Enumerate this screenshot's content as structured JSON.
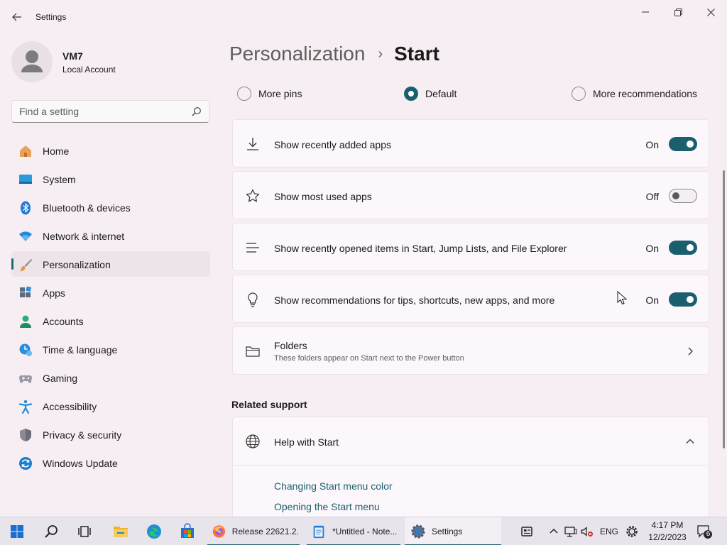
{
  "window": {
    "app_title": "Settings"
  },
  "profile": {
    "name": "VM7",
    "account_type": "Local Account"
  },
  "search": {
    "placeholder": "Find a setting",
    "value": ""
  },
  "sidebar": {
    "items": [
      {
        "label": "Home",
        "icon": "home-icon"
      },
      {
        "label": "System",
        "icon": "system-icon"
      },
      {
        "label": "Bluetooth & devices",
        "icon": "bluetooth-icon"
      },
      {
        "label": "Network & internet",
        "icon": "wifi-icon"
      },
      {
        "label": "Personalization",
        "icon": "brush-icon",
        "selected": true
      },
      {
        "label": "Apps",
        "icon": "apps-icon"
      },
      {
        "label": "Accounts",
        "icon": "accounts-icon"
      },
      {
        "label": "Time & language",
        "icon": "time-language-icon"
      },
      {
        "label": "Gaming",
        "icon": "gamepad-icon"
      },
      {
        "label": "Accessibility",
        "icon": "accessibility-icon"
      },
      {
        "label": "Privacy & security",
        "icon": "shield-icon"
      },
      {
        "label": "Windows Update",
        "icon": "update-icon"
      }
    ]
  },
  "breadcrumb": {
    "parent": "Personalization",
    "separator": "›",
    "current": "Start"
  },
  "layout_options": [
    {
      "label": "More pins",
      "selected": false
    },
    {
      "label": "Default",
      "selected": true
    },
    {
      "label": "More recommendations",
      "selected": false
    }
  ],
  "settings": [
    {
      "title": "Show recently added apps",
      "state": "On",
      "on": true,
      "icon": "download-icon"
    },
    {
      "title": "Show most used apps",
      "state": "Off",
      "on": false,
      "icon": "star-icon"
    },
    {
      "title": "Show recently opened items in Start, Jump Lists, and File Explorer",
      "state": "On",
      "on": true,
      "icon": "list-icon"
    },
    {
      "title": "Show recommendations for tips, shortcuts, new apps, and more",
      "state": "On",
      "on": true,
      "icon": "lightbulb-icon"
    }
  ],
  "folders": {
    "title": "Folders",
    "subtitle": "These folders appear on Start next to the Power button",
    "icon": "folder-icon"
  },
  "related_support": {
    "heading": "Related support",
    "help_title": "Help with Start",
    "links": [
      "Changing Start menu color",
      "Opening the Start menu"
    ]
  },
  "taskbar": {
    "apps": [
      {
        "label": "Release 22621.2...",
        "icon": "firefox-icon"
      },
      {
        "label": "*Untitled - Note...",
        "icon": "notepad-icon"
      },
      {
        "label": "Settings",
        "icon": "settings-gear-icon"
      }
    ],
    "language": "ENG",
    "time": "4:17 PM",
    "date": "12/2/2023",
    "notification_count": "6"
  },
  "colors": {
    "accent": "#1b5f6e",
    "background": "#f6eef3",
    "card": "#fbf7fa"
  }
}
